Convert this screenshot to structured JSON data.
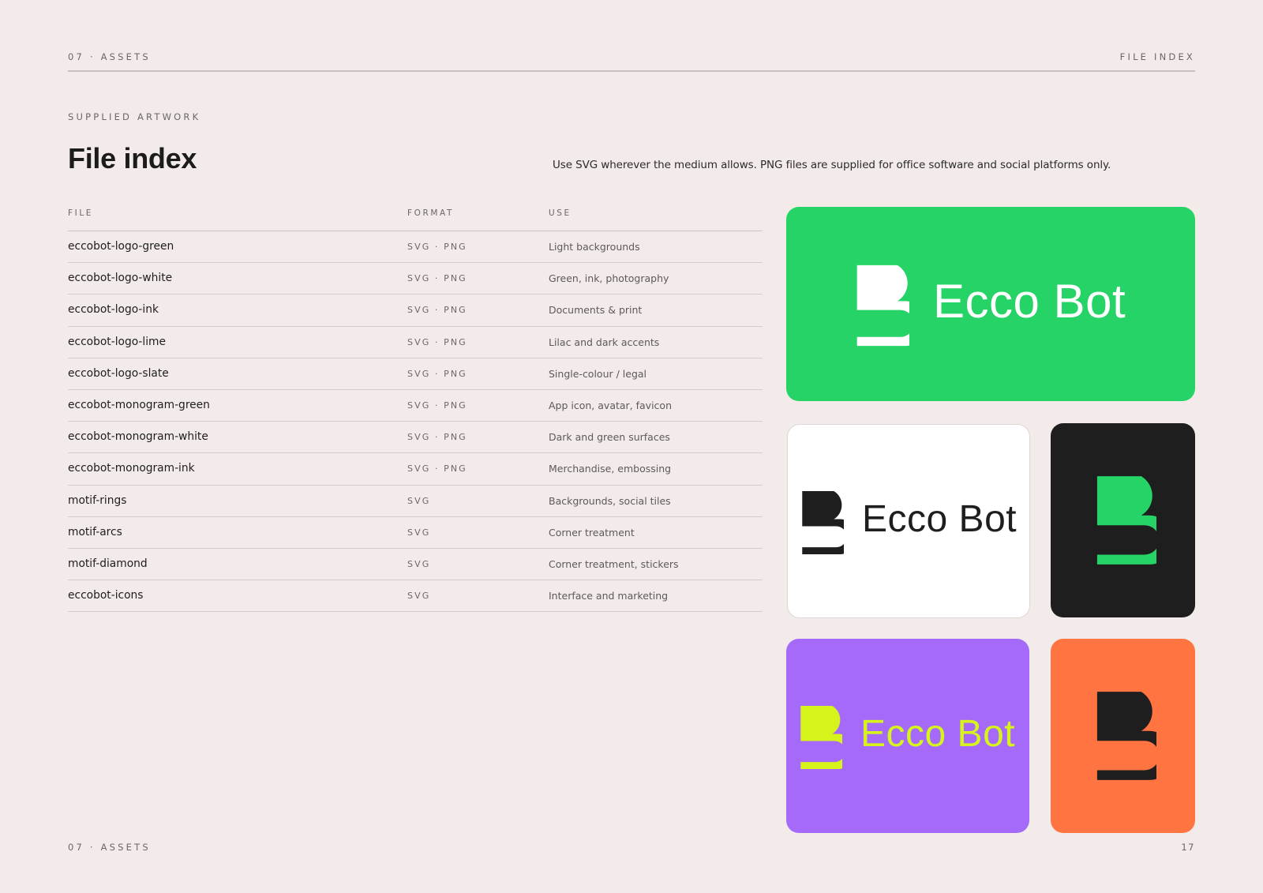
{
  "header": {
    "section": "07 · ASSETS",
    "page_label": "FILE INDEX"
  },
  "kicker": "SUPPLIED ARTWORK",
  "title": "File index",
  "intro": "Use SVG wherever the medium allows. PNG files are supplied for office software and social platforms only.",
  "table": {
    "columns": {
      "file": "FILE",
      "format": "FORMAT",
      "use": "USE"
    },
    "rows": [
      {
        "file": "eccobot-logo-green",
        "format": "SVG · PNG",
        "use": "Light backgrounds"
      },
      {
        "file": "eccobot-logo-white",
        "format": "SVG · PNG",
        "use": "Green, ink, photography"
      },
      {
        "file": "eccobot-logo-ink",
        "format": "SVG · PNG",
        "use": "Documents & print"
      },
      {
        "file": "eccobot-logo-lime",
        "format": "SVG · PNG",
        "use": "Lilac and dark accents"
      },
      {
        "file": "eccobot-logo-slate",
        "format": "SVG · PNG",
        "use": "Single-colour / legal"
      },
      {
        "file": "eccobot-monogram-green",
        "format": "SVG · PNG",
        "use": "App icon, avatar, favicon"
      },
      {
        "file": "eccobot-monogram-white",
        "format": "SVG · PNG",
        "use": "Dark and green surfaces"
      },
      {
        "file": "eccobot-monogram-ink",
        "format": "SVG · PNG",
        "use": "Merchandise, embossing"
      },
      {
        "file": "motif-rings",
        "format": "SVG",
        "use": "Backgrounds, social tiles"
      },
      {
        "file": "motif-arcs",
        "format": "SVG",
        "use": "Corner treatment"
      },
      {
        "file": "motif-diamond",
        "format": "SVG",
        "use": "Corner treatment, stickers"
      },
      {
        "file": "eccobot-icons",
        "format": "SVG",
        "use": "Interface and marketing"
      }
    ]
  },
  "tiles": {
    "green": {
      "wordmark": "Ecco Bot",
      "bg": "#26d366",
      "fg": "#ffffff"
    },
    "white": {
      "wordmark": "Ecco Bot",
      "bg": "#ffffff",
      "fg": "#1e1e1e"
    },
    "ink": {
      "bg": "#1e1e1e",
      "fg": "#26d366"
    },
    "lilac": {
      "wordmark": "Ecco Bot",
      "bg": "#a56afa",
      "fg": "#d6f31b"
    },
    "orange": {
      "bg": "#ff7440",
      "fg": "#1e1e1e"
    }
  },
  "footer": {
    "section": "07 · ASSETS",
    "page_number": "17"
  }
}
